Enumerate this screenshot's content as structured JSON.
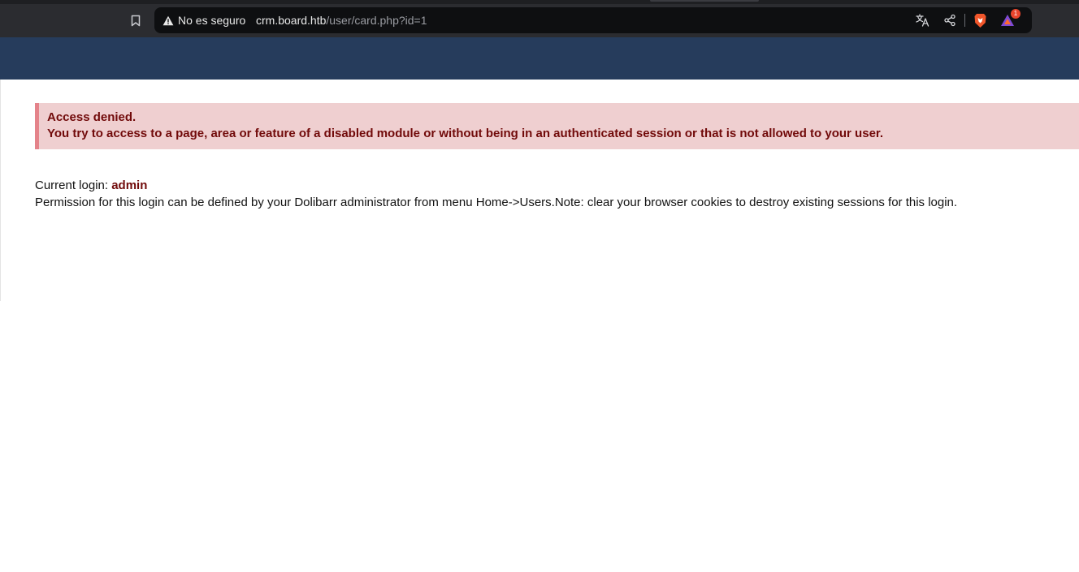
{
  "browser": {
    "security_label": "No es seguro",
    "url_host": "crm.board.htb",
    "url_path": "/user/card.php?id=1",
    "notification_count": "1",
    "icons": [
      "bookmark-icon",
      "warning-icon",
      "translate-icon",
      "share-icon",
      "brave-shield-icon",
      "brave-rewards-icon"
    ]
  },
  "error": {
    "title": "Access denied.",
    "message": "You try to access to a page, area or feature of a disabled module or without being in an authenticated session or that is not allowed to your user."
  },
  "login": {
    "label": "Current login: ",
    "user": "admin",
    "permission_note": "Permission for this login can be defined by your Dolibarr administrator from menu Home->Users.Note: clear your browser cookies to destroy existing sessions for this login."
  },
  "colors": {
    "header": "#263c5c",
    "error_bg": "#efcfd0",
    "error_border": "#e4838a",
    "error_text": "#710a0a"
  }
}
